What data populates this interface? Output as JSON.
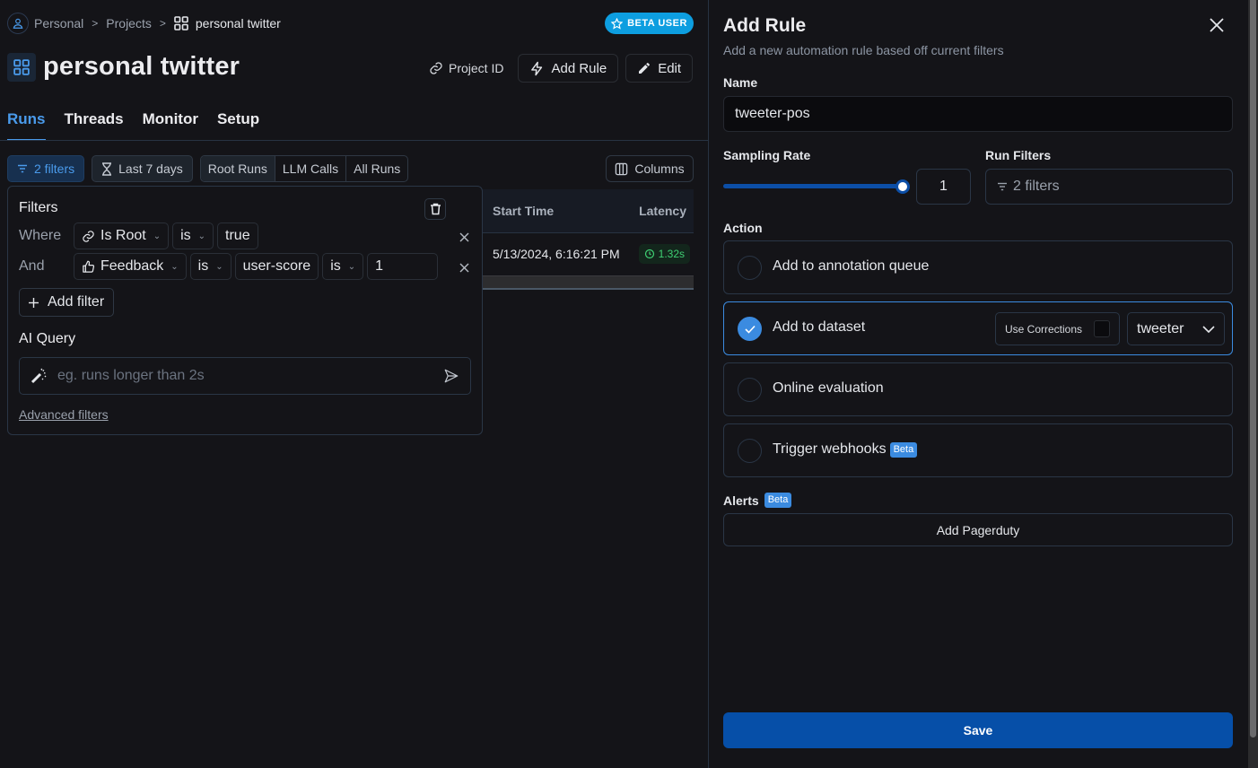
{
  "breadcrumb": {
    "items": [
      "Personal",
      "Projects"
    ],
    "current": "personal twitter",
    "separator": ">"
  },
  "beta_badge": "BETA USER",
  "header": {
    "title": "personal twitter",
    "project_id_label": "Project ID",
    "add_rule_label": "Add Rule",
    "edit_label": "Edit"
  },
  "tabs": [
    {
      "label": "Runs",
      "active": true
    },
    {
      "label": "Threads",
      "active": false
    },
    {
      "label": "Monitor",
      "active": false
    },
    {
      "label": "Setup",
      "active": false
    }
  ],
  "toolbar": {
    "filters_label": "2 filters",
    "date_range_label": "Last 7 days",
    "run_types": [
      "Root Runs",
      "LLM Calls",
      "All Runs"
    ],
    "selected_run_type": "Root Runs",
    "columns_label": "Columns"
  },
  "table": {
    "columns": [
      "Start Time",
      "Latency"
    ],
    "rows": [
      {
        "start_time": "5/13/2024, 6:16:21 PM",
        "latency": "1.32s"
      }
    ]
  },
  "filter_panel": {
    "title": "Filters",
    "rows": [
      {
        "conjunction": "Where",
        "field": "Is Root",
        "field_icon": "link-icon",
        "operator": "is",
        "value": "true"
      },
      {
        "conjunction": "And",
        "field": "Feedback",
        "field_icon": "thumbs-up-icon",
        "operator": "is",
        "key": "user-score",
        "operator2": "is",
        "value": "1"
      }
    ],
    "add_filter_label": "Add filter",
    "ai_query_label": "AI Query",
    "ai_query_placeholder": "eg. runs longer than 2s",
    "advanced_filters_label": "Advanced filters"
  },
  "add_rule": {
    "title": "Add Rule",
    "subtitle": "Add a new automation rule based off current filters",
    "name_label": "Name",
    "name_value": "tweeter-pos",
    "sampling_rate_label": "Sampling Rate",
    "sampling_rate": 1,
    "sampling_rate_display": "1",
    "run_filters_label": "Run Filters",
    "run_filters_value": "2 filters",
    "action_label": "Action",
    "actions": [
      {
        "label": "Add to annotation queue",
        "selected": false
      },
      {
        "label": "Add to dataset",
        "selected": true
      },
      {
        "label": "Online evaluation",
        "selected": false
      },
      {
        "label": "Trigger webhooks",
        "selected": false,
        "badge": "Beta"
      }
    ],
    "use_corrections_label": "Use Corrections",
    "use_corrections_checked": false,
    "dataset_value": "tweeter",
    "alerts_label": "Alerts",
    "alerts_badge": "Beta",
    "add_pagerduty_label": "Add Pagerduty",
    "save_label": "Save"
  },
  "colors": {
    "accent": "#4a9bec",
    "primary_button": "#064fa8",
    "beta_user_badge": "#0d9ee0",
    "latency_ok": "#3fcf73",
    "background": "#141418"
  }
}
